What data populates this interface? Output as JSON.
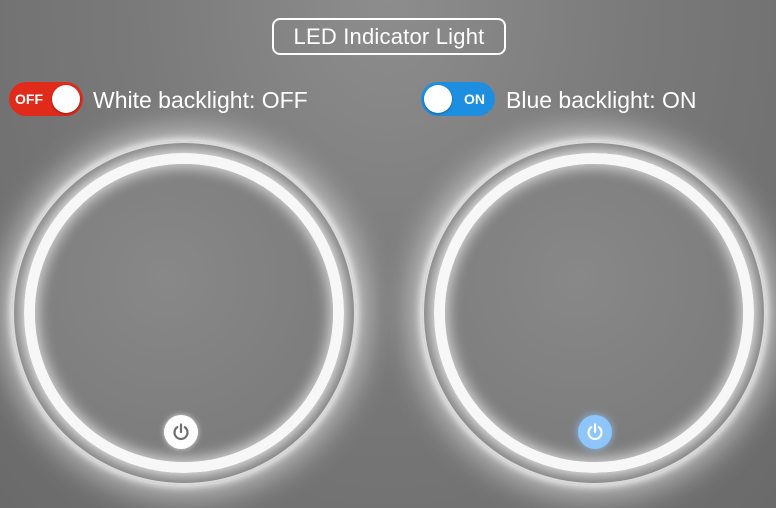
{
  "header": {
    "title": "LED Indicator Light"
  },
  "left_panel": {
    "toggle": {
      "text": "OFF",
      "state": "off",
      "color": "#e02a1a"
    },
    "label": "White backlight: OFF",
    "power_button": {
      "icon": "power-icon",
      "color": "#ffffff",
      "icon_color": "#707070"
    }
  },
  "right_panel": {
    "toggle": {
      "text": "ON",
      "state": "on",
      "color": "#1e8fe0"
    },
    "label": "Blue backlight: ON",
    "power_button": {
      "icon": "power-icon",
      "color": "#8ec5fb",
      "icon_color": "#ffffff"
    }
  },
  "colors": {
    "ring_light": "#f7f7f7",
    "background": "#7a7a7a"
  }
}
